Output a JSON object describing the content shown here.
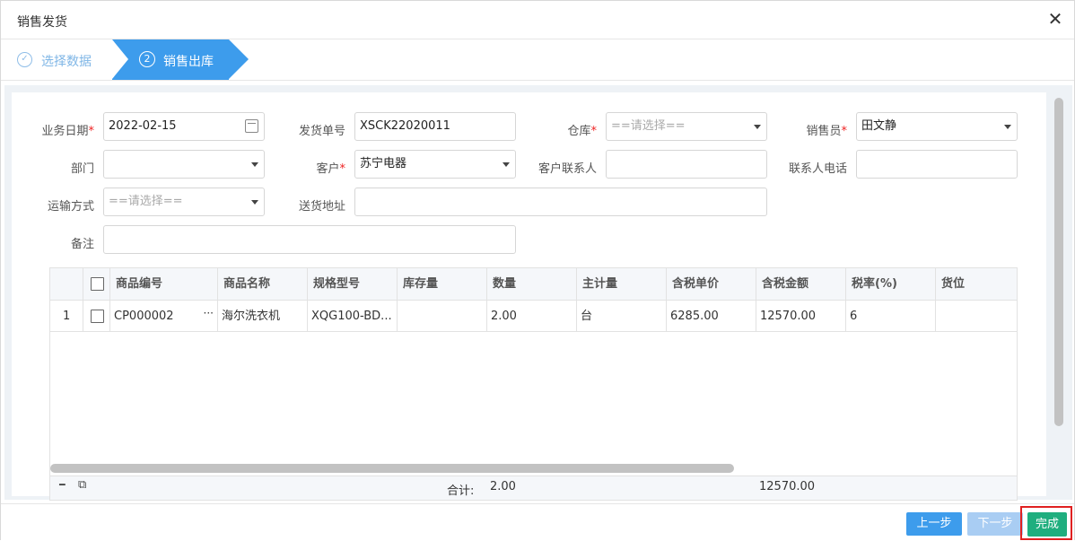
{
  "dialog": {
    "title": "销售发货",
    "close_glyph": "✕"
  },
  "steps": [
    {
      "label": "选择数据",
      "icon_glyph": "✓",
      "state": "done"
    },
    {
      "label": "销售出库",
      "num": "②",
      "state": "active"
    }
  ],
  "form": {
    "date_label": "业务日期",
    "date_value": "2022-02-15",
    "docno_label": "发货单号",
    "docno_value": "XSCK22020011",
    "warehouse_label": "仓库",
    "warehouse_placeholder": "==请选择==",
    "salesman_label": "销售员",
    "salesman_value": "田文静",
    "dept_label": "部门",
    "dept_value": "",
    "customer_label": "客户",
    "customer_value": "苏宁电器",
    "contact_label": "客户联系人",
    "contact_value": "",
    "phone_label": "联系人电话",
    "phone_value": "",
    "transport_label": "运输方式",
    "transport_placeholder": "==请选择==",
    "address_label": "送货地址",
    "address_value": "",
    "remark_label": "备注",
    "remark_value": "",
    "required_mark": "*"
  },
  "grid": {
    "columns": [
      "商品编号",
      "商品名称",
      "规格型号",
      "库存量",
      "数量",
      "主计量",
      "含税单价",
      "含税金额",
      "税率(%)",
      "货位"
    ],
    "rows": [
      {
        "index": "1",
        "code": "CP000002",
        "more": "···",
        "name": "海尔洗衣机",
        "spec": "XQG100-BD...",
        "stock": "",
        "qty": "2.00",
        "unit": "台",
        "price": "6285.00",
        "amount": "12570.00",
        "tax": "6",
        "location": ""
      }
    ],
    "footer": {
      "sum_label": "合计:",
      "sum_qty": "2.00",
      "sum_amount": "12570.00",
      "minus_glyph": "━",
      "copy_glyph": "⧉"
    }
  },
  "buttons": {
    "prev": "上一步",
    "next": "下一步",
    "done": "完成"
  }
}
